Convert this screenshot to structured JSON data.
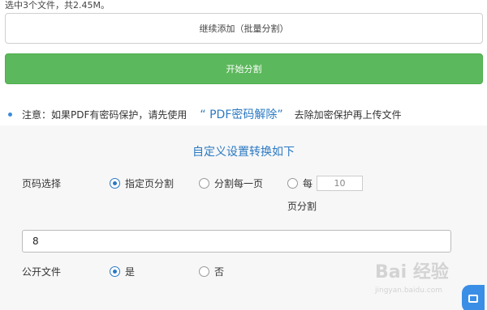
{
  "upload": {
    "selected_info": "选中3个文件，共2.45M。",
    "continue_button": "继续添加（批量分割）",
    "start_button": "开始分割"
  },
  "notice": {
    "prefix": "注意：如果PDF有密码保护，请先使用",
    "link": "“ PDF密码解除”",
    "suffix": "去除加密保护再上传文件"
  },
  "settings": {
    "title": "自定义设置转换如下",
    "page_select": {
      "label": "页码选择",
      "options": [
        "指定页分割",
        "分割每一页",
        "每"
      ],
      "selected": "指定页分割",
      "every_n_value": "10",
      "every_n_suffix": "页分割"
    },
    "page_input_value": "8",
    "public_file": {
      "label": "公开文件",
      "options": [
        "是",
        "否"
      ],
      "selected": "是"
    }
  },
  "colors": {
    "accent": "#2b79c2",
    "start_button": "#5cb85c",
    "settings_bg": "#f7f7f7"
  },
  "icons": {
    "floating_button": "chat-icon"
  }
}
